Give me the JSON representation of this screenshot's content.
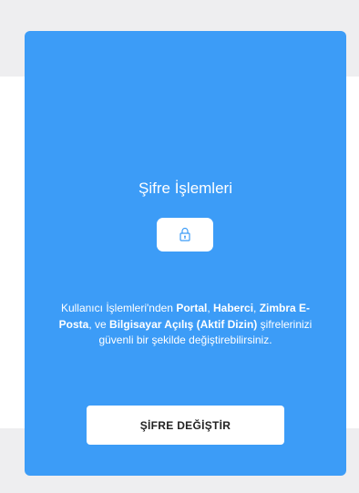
{
  "card": {
    "title": "Şifre İşlemleri",
    "icon": "lock-icon",
    "description": {
      "part1": "Kullanıcı İşlemleri'nden ",
      "bold1": "Portal",
      "sep1": ", ",
      "bold2": "Haberci",
      "sep2": ", ",
      "bold3": "Zimbra E-Posta",
      "sep3": ", ve ",
      "bold4": "Bilgisayar Açılış (Aktif Dizin)",
      "part2": " şifrelerinizi güvenli bir şekilde değiştirebilirsiniz."
    },
    "button_label": "ŞİFRE DEĞİŞTİR"
  },
  "colors": {
    "card_background": "#3c9cf7",
    "page_band": "#eeeef0",
    "button_background": "#ffffff",
    "button_text": "#222222"
  }
}
